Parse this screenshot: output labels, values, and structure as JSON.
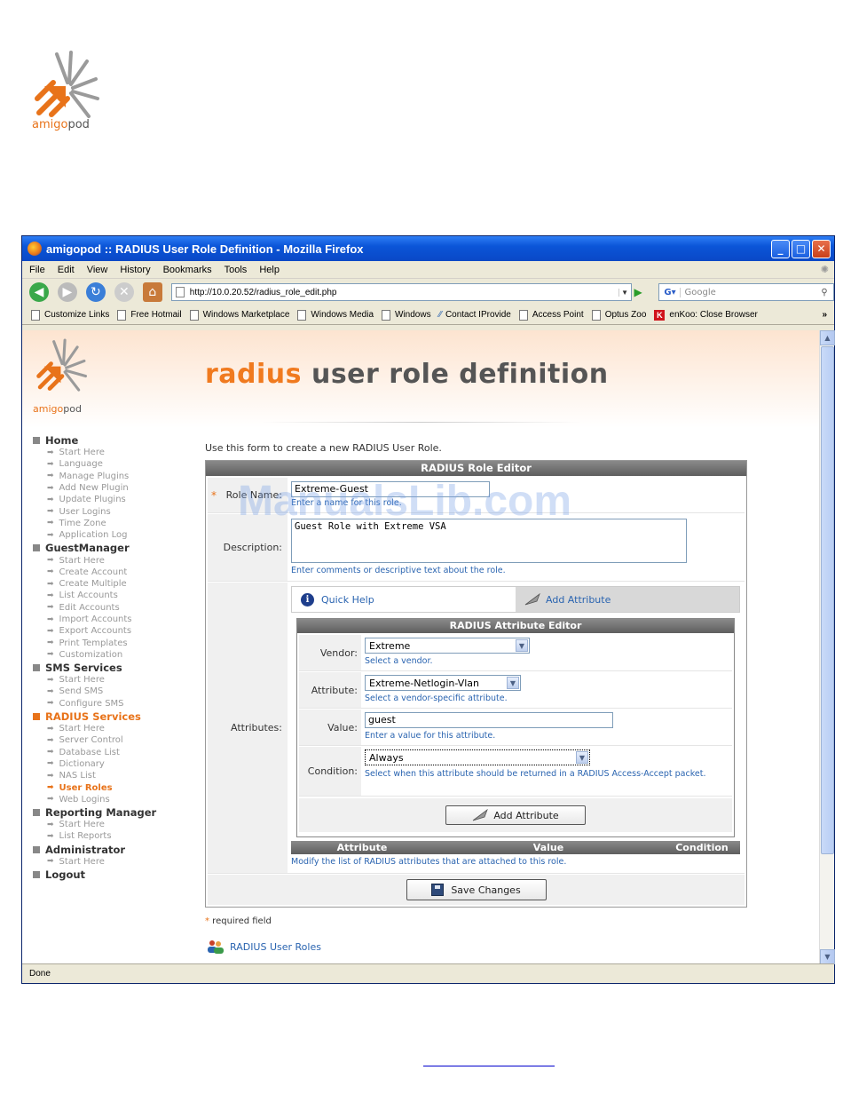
{
  "doc": {
    "logo_text_a": "amigo",
    "logo_text_b": "pod"
  },
  "window": {
    "title": "amigopod :: RADIUS User Role Definition - Mozilla Firefox",
    "menu": [
      "File",
      "Edit",
      "View",
      "History",
      "Bookmarks",
      "Tools",
      "Help"
    ],
    "url": "http://10.0.20.52/radius_role_edit.php",
    "search_placeholder": "Google",
    "bookmarks": [
      "Customize Links",
      "Free Hotmail",
      "Windows Marketplace",
      "Windows Media",
      "Windows",
      "Contact IProvide",
      "Access Point",
      "Optus Zoo",
      "enKoo: Close Browser"
    ],
    "bookmarks_more": "»",
    "status": "Done"
  },
  "site": {
    "logo_text_a": "amigo",
    "logo_text_b": "pod",
    "heading_accent": "radius",
    "heading_rest": " user role definition",
    "watermark": "ManualsLib.com"
  },
  "sidebar": {
    "sections": [
      {
        "label": "Home",
        "active": false,
        "items": [
          "Start Here",
          "Language",
          "Manage Plugins",
          "Add New Plugin",
          "Update Plugins",
          "User Logins",
          "Time Zone",
          "Application Log"
        ]
      },
      {
        "label": "GuestManager",
        "active": false,
        "items": [
          "Start Here",
          "Create Account",
          "Create Multiple",
          "List Accounts",
          "Edit Accounts",
          "Import Accounts",
          "Export Accounts",
          "Print Templates",
          "Customization"
        ]
      },
      {
        "label": "SMS Services",
        "active": false,
        "items": [
          "Start Here",
          "Send SMS",
          "Configure SMS"
        ]
      },
      {
        "label": "RADIUS Services",
        "active": true,
        "items": [
          "Start Here",
          "Server Control",
          "Database List",
          "Dictionary",
          "NAS List",
          "User Roles",
          "Web Logins"
        ],
        "active_item": "User Roles"
      },
      {
        "label": "Reporting Manager",
        "active": false,
        "items": [
          "Start Here",
          "List Reports"
        ]
      },
      {
        "label": "Administrator",
        "active": false,
        "items": [
          "Start Here"
        ]
      },
      {
        "label": "Logout",
        "active": false,
        "items": []
      }
    ]
  },
  "form": {
    "intro": "Use this form to create a new RADIUS User Role.",
    "title": "RADIUS Role Editor",
    "role_name_label": "Role Name:",
    "role_name_value": "Extreme-Guest",
    "role_name_hint": "Enter a name for this role.",
    "description_label": "Description:",
    "description_value": "Guest Role with Extreme VSA",
    "description_hint": "Enter comments or descriptive text about the role.",
    "attributes_label": "Attributes:",
    "quick_help": "Quick Help",
    "add_attribute_tab": "Add Attribute",
    "attr_editor_title": "RADIUS Attribute Editor",
    "vendor_label": "Vendor:",
    "vendor_value": "Extreme",
    "vendor_hint": "Select a vendor.",
    "attribute_label": "Attribute:",
    "attribute_value": "Extreme-Netlogin-Vlan",
    "attribute_hint": "Select a vendor-specific attribute.",
    "value_label": "Value:",
    "value_value": "guest",
    "value_hint": "Enter a value for this attribute.",
    "condition_label": "Condition:",
    "condition_value": "Always",
    "condition_hint": "Select when this attribute should be returned in a RADIUS Access-Accept packet.",
    "add_attribute_button": "Add Attribute",
    "col_attribute": "Attribute",
    "col_value": "Value",
    "col_condition": "Condition",
    "attributes_hint": "Modify the list of RADIUS attributes that are attached to this role.",
    "save_button": "Save Changes",
    "required_star": "*",
    "required_note": " required field",
    "roles_link": "RADIUS User Roles"
  }
}
